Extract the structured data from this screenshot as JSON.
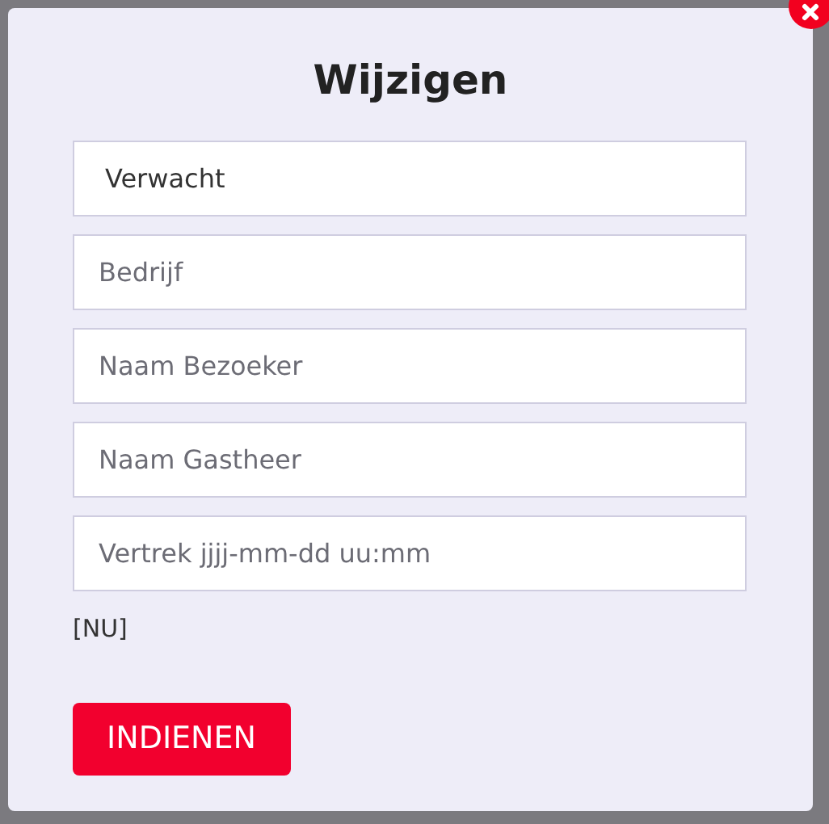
{
  "dialog": {
    "title": "Wijzigen",
    "status_select": {
      "value": "Verwacht"
    },
    "fields": [
      {
        "placeholder": "Bedrijf"
      },
      {
        "placeholder": "Naam Bezoeker"
      },
      {
        "placeholder": "Naam Gastheer"
      },
      {
        "placeholder": "Vertrek jjjj-mm-dd uu:mm"
      }
    ],
    "now_link": "[NU]",
    "submit_button": "INDIENEN"
  }
}
